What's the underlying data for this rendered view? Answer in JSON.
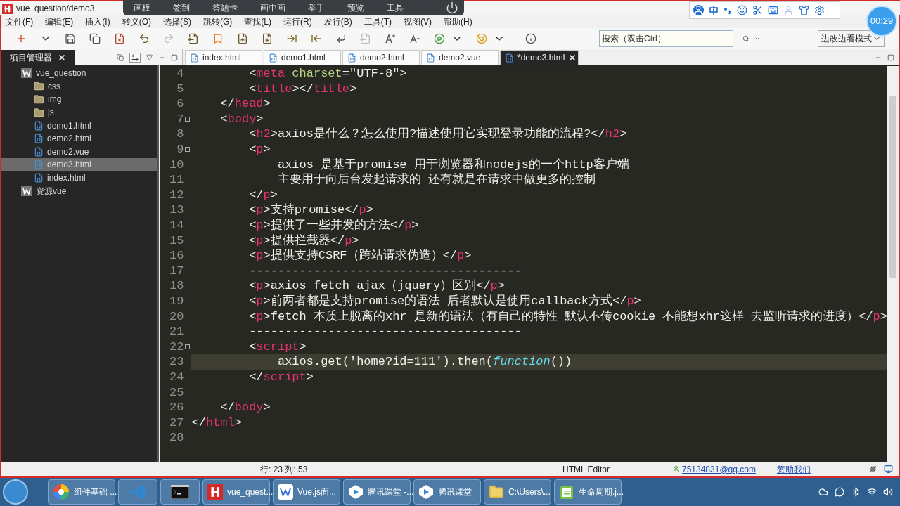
{
  "window": {
    "title": "vue_question/demo3"
  },
  "overlay_toolbar": {
    "items": [
      "画板",
      "签到",
      "答题卡",
      "画中画",
      "举手",
      "预览",
      "工具"
    ]
  },
  "timer": "00:29",
  "menu": [
    "文件(F)",
    "编辑(E)",
    "插入(I)",
    "转义(O)",
    "选择(S)",
    "跳转(G)",
    "查找(L)",
    "运行(R)",
    "发行(B)",
    "工具(T)",
    "视图(V)",
    "帮助(H)"
  ],
  "search": {
    "placeholder": "搜索（双击Ctrl）"
  },
  "mode_select": {
    "value": "边改边看模式"
  },
  "sidebar": {
    "title": "项目管理器",
    "tree": [
      {
        "label": "vue_question",
        "kind": "project",
        "selected": false,
        "children": [
          {
            "label": "css",
            "kind": "folder",
            "selected": false
          },
          {
            "label": "img",
            "kind": "folder",
            "selected": false
          },
          {
            "label": "js",
            "kind": "folder",
            "selected": false
          },
          {
            "label": "demo1.html",
            "kind": "file",
            "selected": false
          },
          {
            "label": "demo2.html",
            "kind": "file",
            "selected": false
          },
          {
            "label": "demo2.vue",
            "kind": "file",
            "selected": false
          },
          {
            "label": "demo3.html",
            "kind": "file",
            "selected": true
          },
          {
            "label": "index.html",
            "kind": "file",
            "selected": false
          }
        ]
      },
      {
        "label": "资源vue",
        "kind": "project",
        "selected": false
      }
    ]
  },
  "tabs": [
    {
      "label": "index.html",
      "selected": false
    },
    {
      "label": "demo1.html",
      "selected": false
    },
    {
      "label": "demo2.html",
      "selected": false
    },
    {
      "label": "demo2.vue",
      "selected": false
    },
    {
      "label": "*demo3.html",
      "selected": true
    }
  ],
  "code": {
    "lines": [
      {
        "number": "4",
        "fold": false,
        "current": false,
        "tokens": [
          {
            "kind": "punct",
            "text": "        <"
          },
          {
            "kind": "tag",
            "text": "meta "
          },
          {
            "kind": "attr",
            "text": "charset"
          },
          {
            "kind": "punct",
            "text": "=\"UTF-8\">"
          }
        ]
      },
      {
        "number": "5",
        "fold": false,
        "current": false,
        "tokens": [
          {
            "kind": "punct",
            "text": "        <"
          },
          {
            "kind": "tag",
            "text": "title"
          },
          {
            "kind": "punct",
            "text": "></"
          },
          {
            "kind": "tag",
            "text": "title"
          },
          {
            "kind": "punct",
            "text": ">"
          }
        ]
      },
      {
        "number": "6",
        "fold": false,
        "current": false,
        "tokens": [
          {
            "kind": "punct",
            "text": "    </"
          },
          {
            "kind": "tag",
            "text": "head"
          },
          {
            "kind": "punct",
            "text": ">"
          }
        ]
      },
      {
        "number": "7",
        "fold": true,
        "current": false,
        "tokens": [
          {
            "kind": "punct",
            "text": "    <"
          },
          {
            "kind": "tag",
            "text": "body"
          },
          {
            "kind": "punct",
            "text": ">"
          }
        ]
      },
      {
        "number": "8",
        "fold": false,
        "current": false,
        "tokens": [
          {
            "kind": "punct",
            "text": "        <"
          },
          {
            "kind": "tag",
            "text": "h2"
          },
          {
            "kind": "punct",
            "text": ">axios是什么？怎么使用?描述使用它实现登录功能的流程?</"
          },
          {
            "kind": "tag",
            "text": "h2"
          },
          {
            "kind": "punct",
            "text": ">"
          }
        ]
      },
      {
        "number": "9",
        "fold": true,
        "current": false,
        "tokens": [
          {
            "kind": "punct",
            "text": "        <"
          },
          {
            "kind": "tag",
            "text": "p"
          },
          {
            "kind": "punct",
            "text": ">"
          }
        ]
      },
      {
        "number": "10",
        "fold": false,
        "current": false,
        "tokens": [
          {
            "kind": "punct",
            "text": "            axios 是基于promise 用于浏览器和nodejs的一个http客户端"
          }
        ]
      },
      {
        "number": "11",
        "fold": false,
        "current": false,
        "tokens": [
          {
            "kind": "punct",
            "text": "            主要用于向后台发起请求的 还有就是在请求中做更多的控制"
          }
        ]
      },
      {
        "number": "12",
        "fold": false,
        "current": false,
        "tokens": [
          {
            "kind": "punct",
            "text": "        </"
          },
          {
            "kind": "tag",
            "text": "p"
          },
          {
            "kind": "punct",
            "text": ">"
          }
        ]
      },
      {
        "number": "13",
        "fold": false,
        "current": false,
        "tokens": [
          {
            "kind": "punct",
            "text": "        <"
          },
          {
            "kind": "tag",
            "text": "p"
          },
          {
            "kind": "punct",
            "text": ">支持promise</"
          },
          {
            "kind": "tag",
            "text": "p"
          },
          {
            "kind": "punct",
            "text": ">"
          }
        ]
      },
      {
        "number": "14",
        "fold": false,
        "current": false,
        "tokens": [
          {
            "kind": "punct",
            "text": "        <"
          },
          {
            "kind": "tag",
            "text": "p"
          },
          {
            "kind": "punct",
            "text": ">提供了一些并发的方法</"
          },
          {
            "kind": "tag",
            "text": "p"
          },
          {
            "kind": "punct",
            "text": ">"
          }
        ]
      },
      {
        "number": "15",
        "fold": false,
        "current": false,
        "tokens": [
          {
            "kind": "punct",
            "text": "        <"
          },
          {
            "kind": "tag",
            "text": "p"
          },
          {
            "kind": "punct",
            "text": ">提供拦截器</"
          },
          {
            "kind": "tag",
            "text": "p"
          },
          {
            "kind": "punct",
            "text": ">"
          }
        ]
      },
      {
        "number": "16",
        "fold": false,
        "current": false,
        "tokens": [
          {
            "kind": "punct",
            "text": "        <"
          },
          {
            "kind": "tag",
            "text": "p"
          },
          {
            "kind": "punct",
            "text": ">提供支持CSRF（跨站请求伪造）</"
          },
          {
            "kind": "tag",
            "text": "p"
          },
          {
            "kind": "punct",
            "text": ">"
          }
        ]
      },
      {
        "number": "17",
        "fold": false,
        "current": false,
        "tokens": [
          {
            "kind": "punct",
            "text": "        --------------------------------------"
          }
        ]
      },
      {
        "number": "18",
        "fold": false,
        "current": false,
        "tokens": [
          {
            "kind": "punct",
            "text": "        <"
          },
          {
            "kind": "tag",
            "text": "p"
          },
          {
            "kind": "punct",
            "text": ">axios fetch ajax（jquery）区别</"
          },
          {
            "kind": "tag",
            "text": "p"
          },
          {
            "kind": "punct",
            "text": ">"
          }
        ]
      },
      {
        "number": "19",
        "fold": false,
        "current": false,
        "tokens": [
          {
            "kind": "punct",
            "text": "        <"
          },
          {
            "kind": "tag",
            "text": "p"
          },
          {
            "kind": "punct",
            "text": ">前两者都是支持promise的语法 后者默认是使用callback方式</"
          },
          {
            "kind": "tag",
            "text": "p"
          },
          {
            "kind": "punct",
            "text": ">"
          }
        ]
      },
      {
        "number": "20",
        "fold": false,
        "current": false,
        "tokens": [
          {
            "kind": "punct",
            "text": "        <"
          },
          {
            "kind": "tag",
            "text": "p"
          },
          {
            "kind": "punct",
            "text": ">fetch 本质上脱离的xhr 是新的语法（有自己的特性 默认不传cookie 不能想xhr这样 去监听请求的进度）</"
          },
          {
            "kind": "tag",
            "text": "p"
          },
          {
            "kind": "punct",
            "text": ">"
          }
        ]
      },
      {
        "number": "21",
        "fold": false,
        "current": false,
        "tokens": [
          {
            "kind": "punct",
            "text": "        --------------------------------------"
          }
        ]
      },
      {
        "number": "22",
        "fold": true,
        "current": false,
        "tokens": [
          {
            "kind": "punct",
            "text": "        <"
          },
          {
            "kind": "tag",
            "text": "script"
          },
          {
            "kind": "punct",
            "text": ">"
          }
        ]
      },
      {
        "number": "23",
        "fold": false,
        "current": true,
        "tokens": [
          {
            "kind": "punct",
            "text": "            axios.get('home?id=111').then("
          },
          {
            "kind": "keyword",
            "text": "function"
          },
          {
            "kind": "punct",
            "text": "())"
          }
        ]
      },
      {
        "number": "24",
        "fold": false,
        "current": false,
        "tokens": [
          {
            "kind": "punct",
            "text": "        </"
          },
          {
            "kind": "tag",
            "text": "script"
          },
          {
            "kind": "punct",
            "text": ">"
          }
        ]
      },
      {
        "number": "25",
        "fold": false,
        "current": false
      },
      {
        "number": "26",
        "fold": false,
        "current": false,
        "tokens": [
          {
            "kind": "punct",
            "text": "    </"
          },
          {
            "kind": "tag",
            "text": "body"
          },
          {
            "kind": "punct",
            "text": ">"
          }
        ]
      },
      {
        "number": "27",
        "fold": false,
        "current": false,
        "tokens": [
          {
            "kind": "punct",
            "text": "</"
          },
          {
            "kind": "tag",
            "text": "html"
          },
          {
            "kind": "punct",
            "text": ">"
          }
        ]
      },
      {
        "number": "28",
        "fold": false,
        "current": false
      }
    ]
  },
  "status_bar": {
    "position": "行: 23 列: 53",
    "editor": "HTML Editor",
    "email": "75134831@qq.com",
    "sponsor": "赞助我们"
  },
  "taskbar": [
    {
      "kind": "colorwheel",
      "label": "组件基础 ..."
    },
    {
      "kind": "vscode"
    },
    {
      "kind": "cmd"
    },
    {
      "kind": "hbuilder",
      "label": "vue_quest..."
    },
    {
      "kind": "wps",
      "label": "Vue.js面..."
    },
    {
      "kind": "tencent",
      "label": "腾讯课堂 -..."
    },
    {
      "kind": "tencent",
      "label": "腾讯课堂"
    },
    {
      "kind": "folder",
      "label": "C:\\Users\\..."
    },
    {
      "kind": "notes",
      "label": "生命周期.j..."
    }
  ]
}
